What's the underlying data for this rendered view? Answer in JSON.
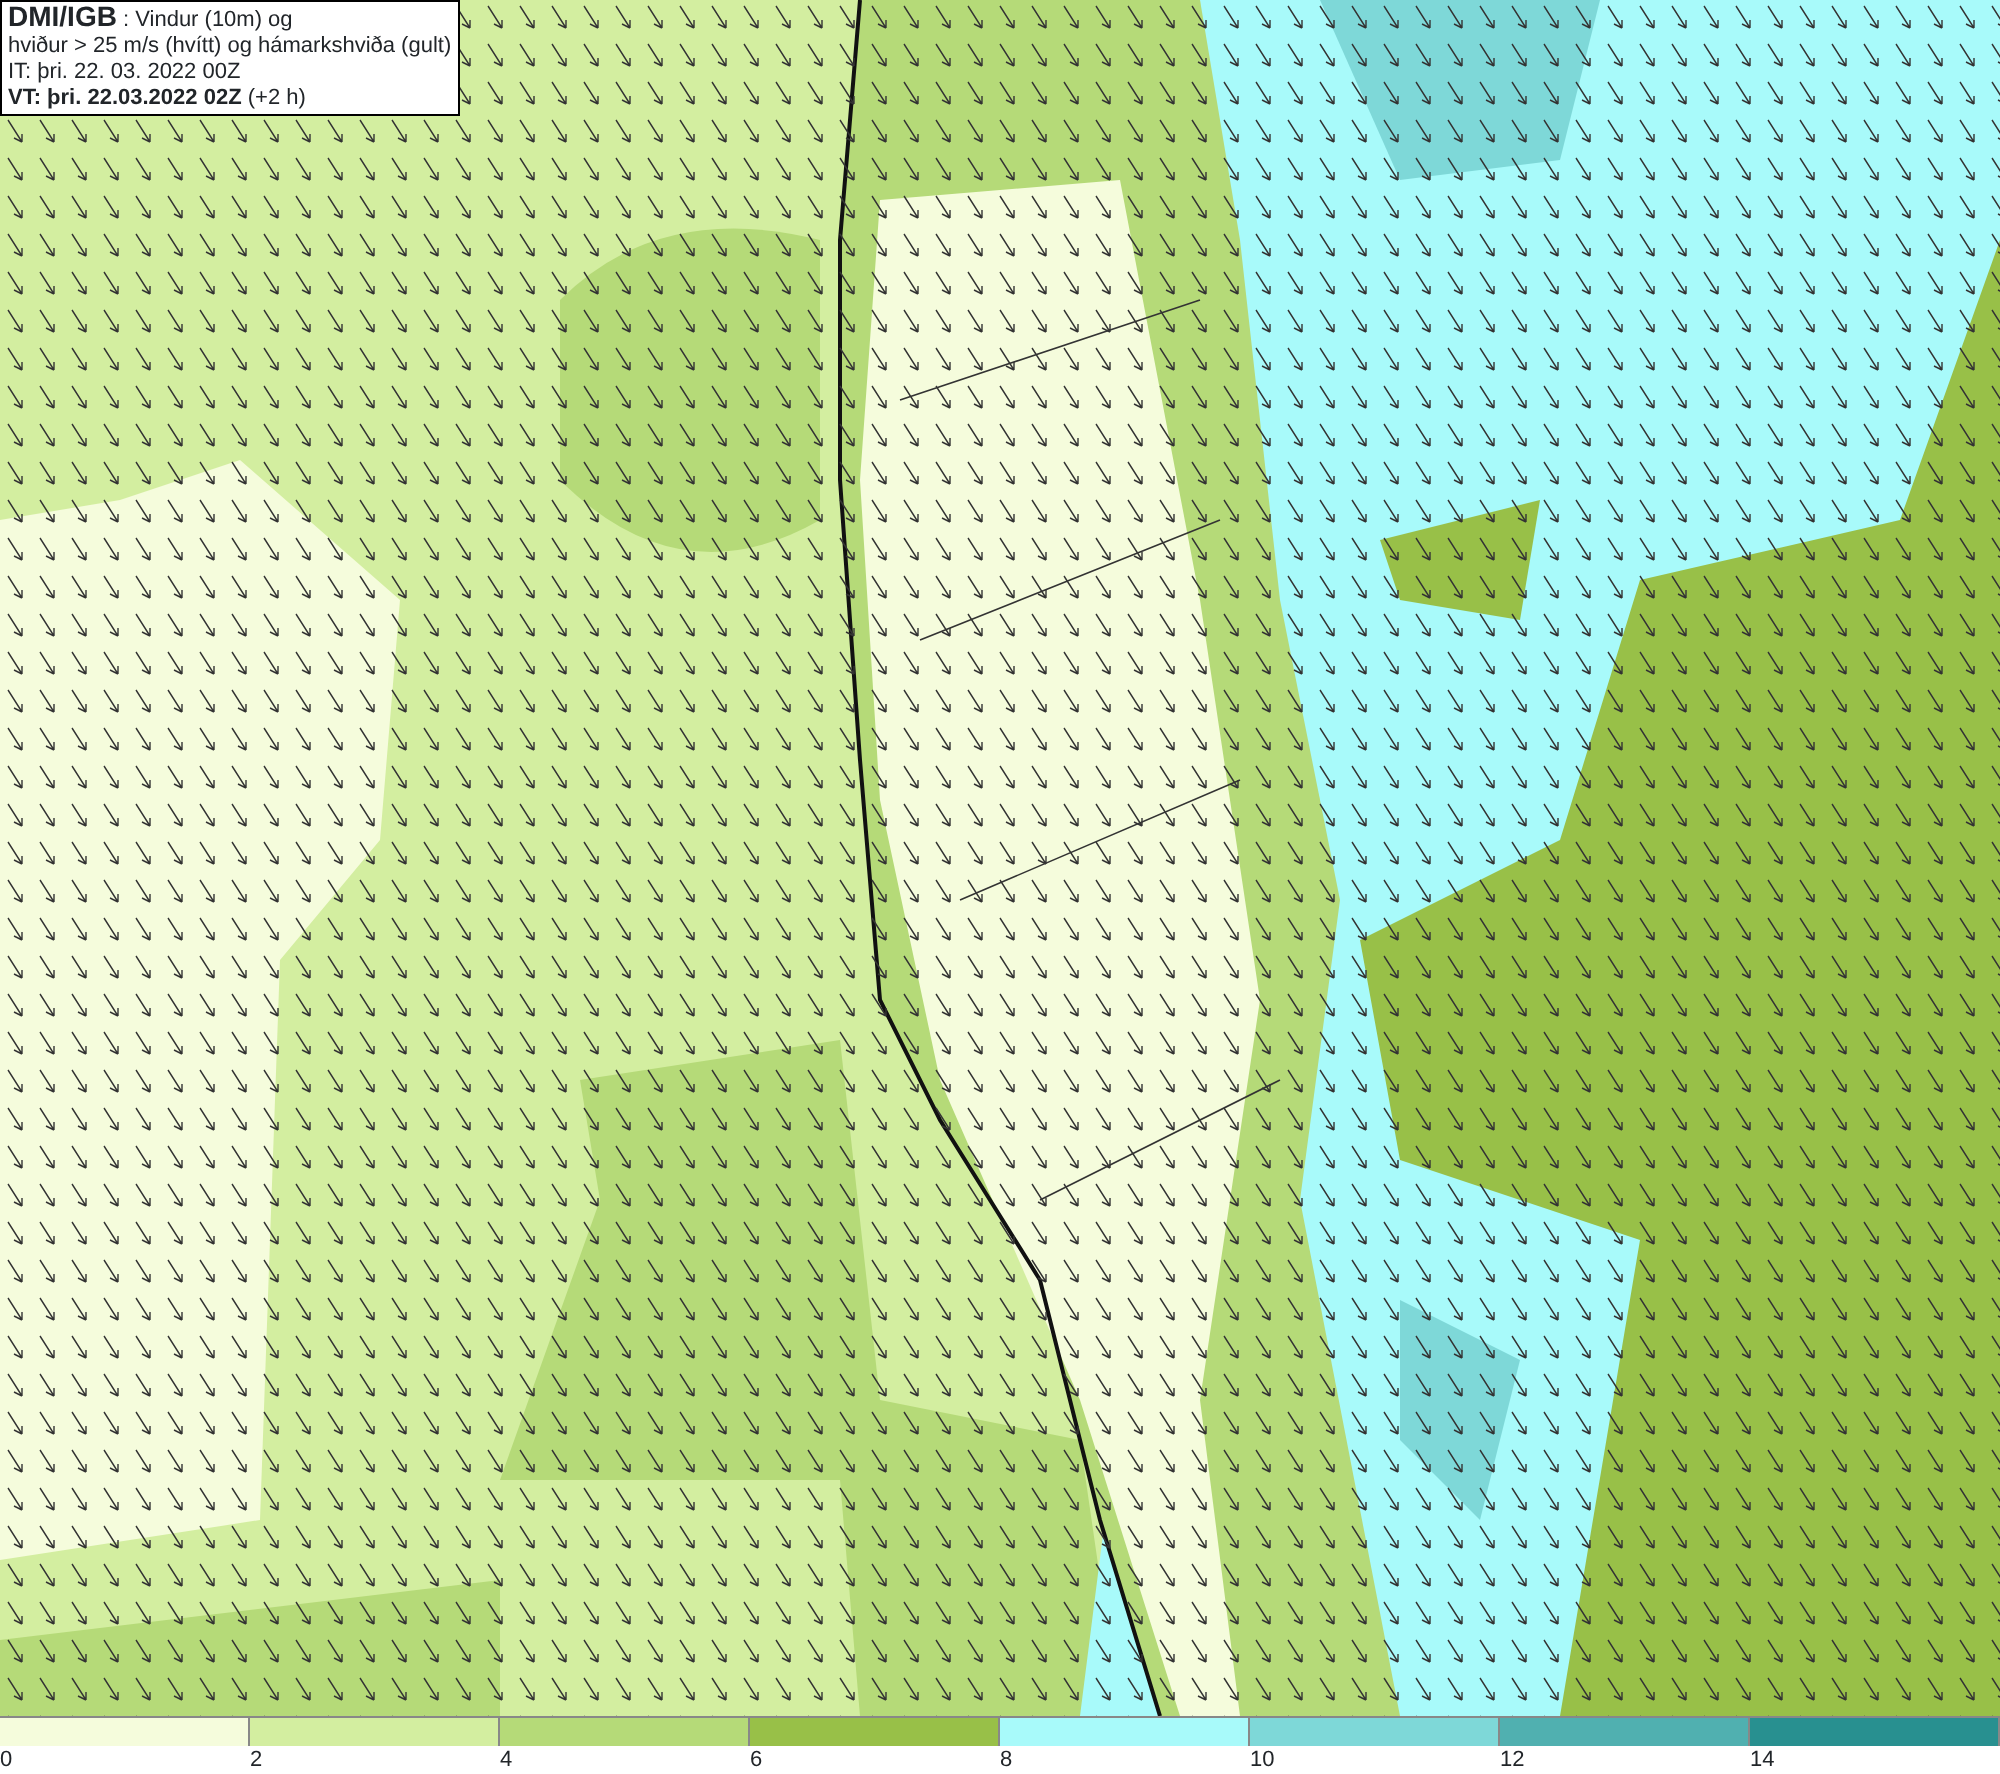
{
  "info_box": {
    "lines": [
      "**DMI/IGB** : Vindur (10m) og",
      "hviður > 25 m/s (hvítt) og hámarkshviða (gult)",
      "IT: þri. 22. 03. 2022 00Z",
      "**VT: þri. 22.03.2022 02Z** (+2 h)"
    ]
  },
  "legend": [
    {
      "label": "0",
      "color": "#f5fcdc"
    },
    {
      "label": "2",
      "color": "#d3eea0"
    },
    {
      "label": "4",
      "color": "#b5da78"
    },
    {
      "label": "6",
      "color": "#98c048"
    },
    {
      "label": "8",
      "color": "#a8fafa"
    },
    {
      "label": "10",
      "color": "#7ed8d8"
    },
    {
      "label": "12",
      "color": "#50b0b0"
    },
    {
      "label": "14",
      "color": "#289090"
    }
  ]
}
